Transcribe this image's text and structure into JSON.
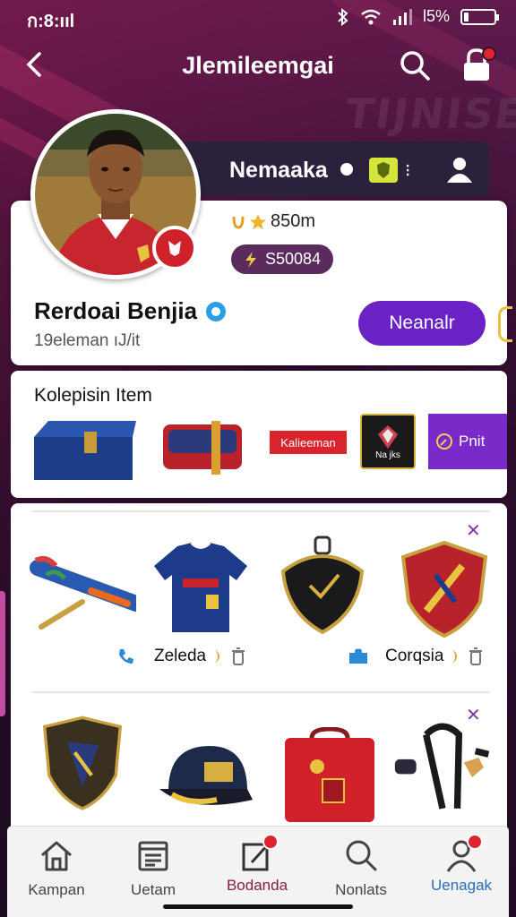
{
  "status_bar": {
    "time": "ก:8:ııl",
    "battery_text": "l5%",
    "battery_level_percent": 15
  },
  "header": {
    "title": "Jlemileemgai"
  },
  "profile": {
    "banner_name": "Nemaaka",
    "coins": "850m",
    "gems": "S50084",
    "name": "Rerdoai Benjia",
    "subtitle": "19eleman ıJ/it",
    "action_label": "Neanalr"
  },
  "collection": {
    "title": "Kolepisin Item",
    "red_tag": "Kalieeman",
    "logo_tag": "Na jks",
    "purple_tag": "Pnit"
  },
  "grid": {
    "row1_label_left": "Zeleda",
    "row1_label_right": "Corqsia"
  },
  "nav": {
    "items": [
      {
        "label": "Kampan"
      },
      {
        "label": "Uetam"
      },
      {
        "label": "Bodanda"
      },
      {
        "label": "Nonlats"
      },
      {
        "label": "Uenagak"
      }
    ]
  },
  "colors": {
    "accent_purple": "#6a22c4",
    "gem_pill": "#5b2b5d",
    "alert_red": "#e0242f",
    "active_nav": "#2a6ebb"
  }
}
